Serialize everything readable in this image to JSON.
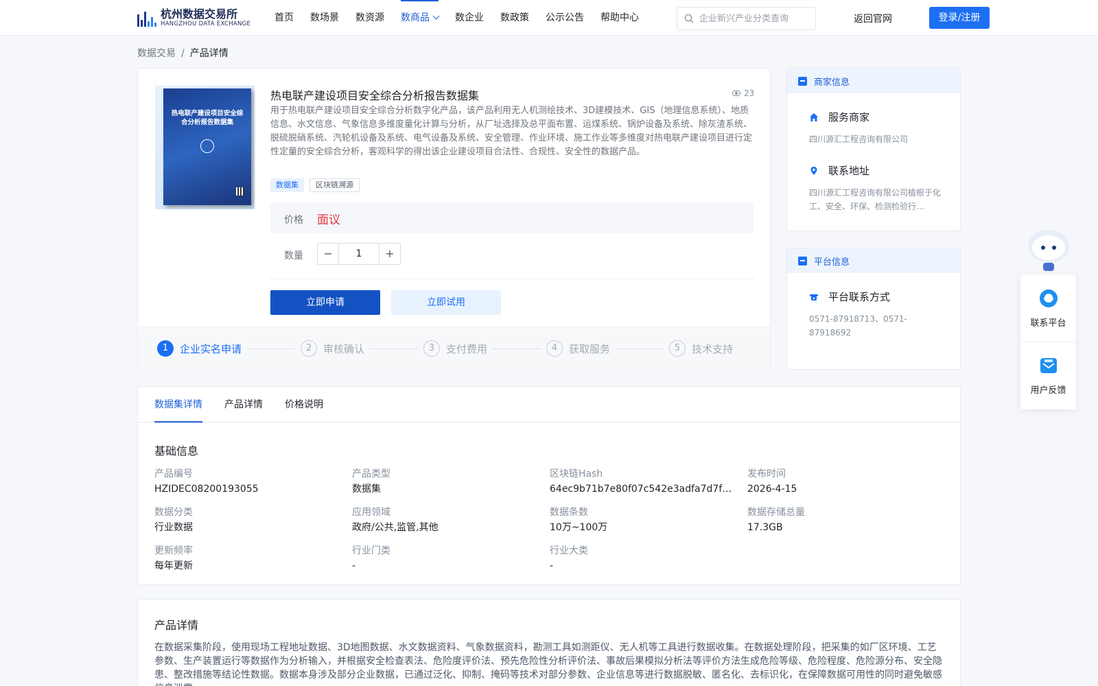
{
  "header": {
    "logo_cn": "杭州数据交易所",
    "logo_en": "HANGZHOU DATA EXCHANGE",
    "nav": [
      {
        "label": "首页",
        "active": false
      },
      {
        "label": "数场景",
        "active": false
      },
      {
        "label": "数资源",
        "active": false
      },
      {
        "label": "数商品",
        "active": true
      },
      {
        "label": "数企业",
        "active": false
      },
      {
        "label": "数政策",
        "active": false
      },
      {
        "label": "公示公告",
        "active": false
      },
      {
        "label": "帮助中心",
        "active": false
      }
    ],
    "search_placeholder": "企业新兴产业分类查询",
    "back_link": "返回官网",
    "login": "登录/注册",
    "icons": {
      "search": "search-icon",
      "dropdown": "chevron-down-icon"
    }
  },
  "breadcrumb": {
    "root": "数据交易",
    "separator": "/",
    "current": "产品详情"
  },
  "product": {
    "cover_title": "热电联产建设项目安全综合分析报告数据集",
    "title": "热电联产建设项目安全综合分析报告数据集",
    "views": "23",
    "description": "用于热电联产建设项目安全综合分析数字化产品，该产品利用无人机测绘技术、3D建模技术、GIS（地理信息系统）、地质信息、水文信息、气象信息多维度量化计算与分析，从厂址选择及总平面布置、运煤系统、锅炉设备及系统、除灰渣系统、脱硫脱硝系统、汽轮机设备及系统、电气设备及系统、安全管理、作业环境、施工作业等多维度对热电联产建设项目进行定性定量的安全综合分析，客观科学的得出该企业建设项目合法性、合规性、安全性的数据产品。",
    "tags": [
      "数据集",
      "区块链溯源"
    ],
    "price_label": "价格",
    "price_value": "面议",
    "qty_label": "数量",
    "qty_value": "1",
    "btn_apply": "立即申请",
    "btn_trial": "立即试用",
    "steps": [
      {
        "num": "1",
        "label": "企业实名申请",
        "active": true
      },
      {
        "num": "2",
        "label": "审核确认",
        "active": false
      },
      {
        "num": "3",
        "label": "支付费用",
        "active": false
      },
      {
        "num": "4",
        "label": "获取服务",
        "active": false
      },
      {
        "num": "5",
        "label": "技术支持",
        "active": false
      }
    ],
    "colors": {
      "price": "#e5393d",
      "primary": "#1d6ff2",
      "primary_dark": "#1452c4"
    }
  },
  "merchant": {
    "head": "商家信息",
    "service_title": "服务商家",
    "service_value": "四川源汇工程咨询有限公司",
    "address_title": "联系地址",
    "address_value": "四川源汇工程咨询有限公司植根于化工、安全、环保、检测检验行…"
  },
  "platform": {
    "head": "平台信息",
    "contact_title": "平台联系方式",
    "contact_value": "0571-87918713、0571-87918692"
  },
  "detail": {
    "tabs": [
      {
        "label": "数据集详情",
        "active": true
      },
      {
        "label": "产品详情",
        "active": false
      },
      {
        "label": "价格说明",
        "active": false
      }
    ],
    "section": "基础信息",
    "fields": [
      {
        "label": "产品编号",
        "value": "HZIDEC08200193055"
      },
      {
        "label": "产品类型",
        "value": "数据集"
      },
      {
        "label": "区块链Hash",
        "value": "64ec9b71b7e80f07c542e3adfa7d7f0c2d3…"
      },
      {
        "label": "发布时间",
        "value": "2026-4-15"
      },
      {
        "label": "数据分类",
        "value": "行业数据"
      },
      {
        "label": "应用领域",
        "value": "政府/公共,监管,其他"
      },
      {
        "label": "数据条数",
        "value": "10万~100万"
      },
      {
        "label": "数据存储总量",
        "value": "17.3GB"
      },
      {
        "label": "更新频率",
        "value": "每年更新"
      },
      {
        "label": "行业门类",
        "value": "-"
      },
      {
        "label": "行业大类",
        "value": "-"
      }
    ]
  },
  "product_detail": {
    "title": "产品详情",
    "text": "在数据采集阶段，使用现场工程地址数据、3D地图数据、水文数据资料、气象数据资料，勘测工具如测距仪、无人机等工具进行数据收集。在数据处理阶段，把采集的如厂区环境、工艺参数、生产装置运行等数据作为分析输入，并根据安全检查表法、危险度评价法、预先危险性分析评价法、事故后果模拟分析法等评价方法生成危险等级、危险程度、危险源分布、安全隐患、整改措施等结论性数据。数据本身涉及部分企业数据，已通过泛化、抑制、掩码等技术对部分参数、企业信息等进行数据脱敏、匿名化、去标识化，在保障数据可用性的同时避免敏感信息泄露。"
  },
  "float": {
    "contact": "联系平台",
    "feedback": "用户反馈"
  }
}
